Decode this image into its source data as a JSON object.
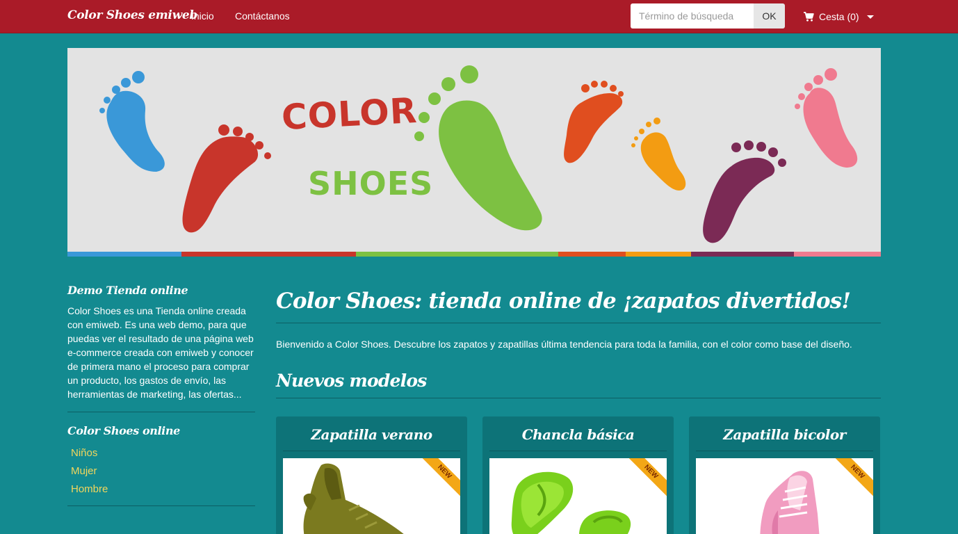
{
  "navbar": {
    "brand": "Color Shoes emiweb",
    "links": [
      "Inicio",
      "Contáctanos"
    ],
    "search_placeholder": "Término de búsqueda",
    "search_button": "OK",
    "cart_label": "Cesta (0)"
  },
  "banner": {
    "line1": "COLOR",
    "line2": "SHOES",
    "footprint_colors": [
      "#3a98d8",
      "#c8352b",
      "#7dc142",
      "#e04e1f",
      "#f39c12",
      "#7b2a55",
      "#f07a8f"
    ]
  },
  "sidebar": {
    "demo_title": "Demo Tienda online",
    "demo_text": "Color Shoes es una Tienda online creada con emiweb. Es una web demo, para que puedas ver el resultado de una página web e-commerce creada con emiweb y conocer de primera mano el proceso para comprar un producto, los gastos de envío, las herramientas de marketing, las ofertas...",
    "categories_title": "Color Shoes online",
    "categories": [
      "Niños",
      "Mujer",
      "Hombre"
    ]
  },
  "main": {
    "title": "Color Shoes: tienda online de ¡zapatos divertidos!",
    "intro": "Bienvenido a Color Shoes. Descubre los zapatos y zapatillas última tendencia para toda la familia, con el color como base del diseño.",
    "section_title": "Nuevos modelos",
    "products": [
      {
        "name": "Zapatilla verano",
        "badge": "NEW"
      },
      {
        "name": "Chancla básica",
        "badge": "NEW"
      },
      {
        "name": "Zapatilla bicolor",
        "badge": "NEW"
      }
    ]
  },
  "colors": {
    "navbar": "#aa1b28",
    "background": "#138a90",
    "link_yellow": "#f2d65c",
    "card": "#0d7378",
    "badge": "#f3a716"
  }
}
